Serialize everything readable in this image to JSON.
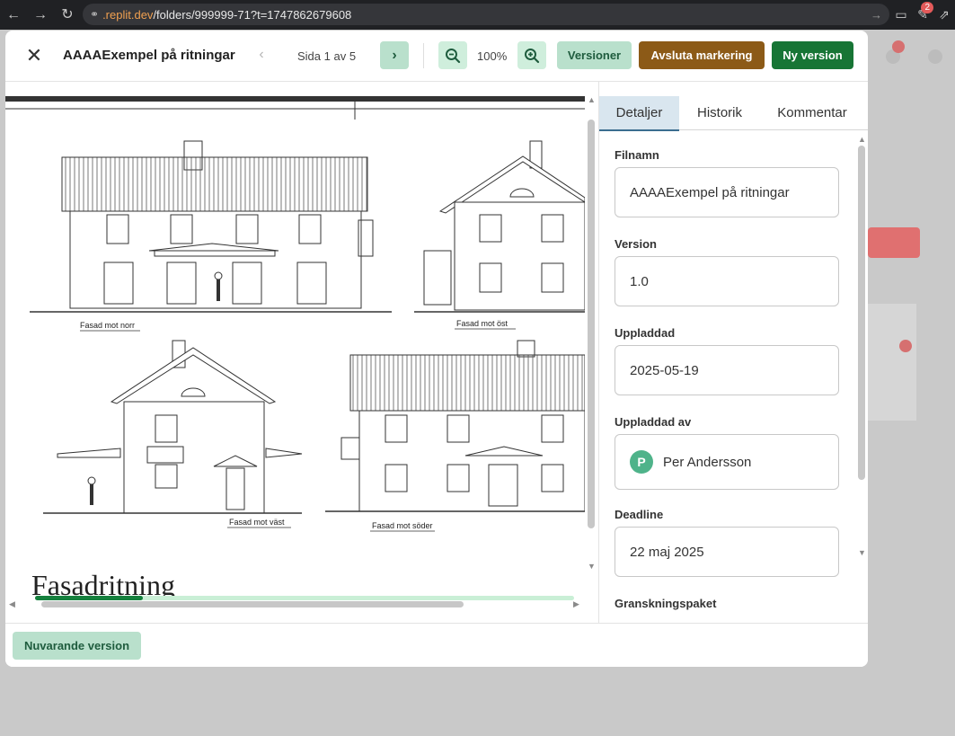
{
  "browser": {
    "url_domain": ".replit.dev",
    "url_path": "/folders/999999-71?t=1747862679608",
    "extension_badge": "2"
  },
  "header": {
    "title": "AAAAExempel på ritningar",
    "page_indicator": "Sida 1 av 5",
    "zoom": "100%",
    "versions_label": "Versioner",
    "end_markup_label": "Avsluta markering",
    "new_version_label": "Ny version"
  },
  "drawing": {
    "north_label": "Fasad mot norr",
    "east_label": "Fasad mot öst",
    "west_label": "Fasad mot väst",
    "south_label": "Fasad mot söder",
    "sheet_title": "Fasadritning"
  },
  "viewer": {
    "scroll_progress": 0.2
  },
  "tabs": [
    "Detaljer",
    "Historik",
    "Kommentar"
  ],
  "details": {
    "filename_label": "Filnamn",
    "filename": "AAAAExempel på ritningar",
    "version_label": "Version",
    "version": "1.0",
    "uploaded_label": "Uppladdad",
    "uploaded": "2025-05-19",
    "uploaded_by_label": "Uppladdad av",
    "uploaded_by": "Per Andersson",
    "uploaded_by_initial": "P",
    "deadline_label": "Deadline",
    "deadline": "22 maj 2025",
    "review_package_label": "Granskningspaket"
  },
  "footer": {
    "current_version_label": "Nuvarande version"
  },
  "colors": {
    "primary_green": "#177535",
    "light_green": "#b9e0cc",
    "brown": "#8c5a17",
    "avatar_green": "#4fb38a"
  }
}
